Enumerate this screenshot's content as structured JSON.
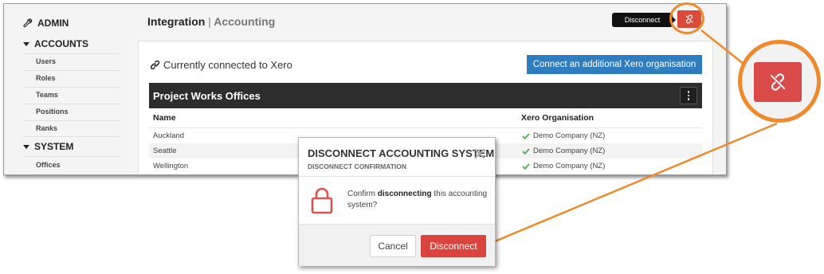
{
  "sidebar": {
    "admin_label": "ADMIN",
    "accounts_label": "ACCOUNTS",
    "accounts_items": [
      "Users",
      "Roles",
      "Teams",
      "Positions",
      "Ranks"
    ],
    "system_label": "SYSTEM",
    "system_items": [
      "Offices"
    ]
  },
  "header": {
    "title": "Integration",
    "separator": "|",
    "crumb": "Accounting",
    "tooltip": "Disconnect"
  },
  "card": {
    "status_text": "Currently connected to Xero",
    "connect_button": "Connect an additional Xero organisation",
    "table_title": "Project Works Offices",
    "columns": [
      "Name",
      "Xero Organisation"
    ],
    "rows": [
      {
        "name": "Auckland",
        "org": "Demo Company (NZ)"
      },
      {
        "name": "Seattle",
        "org": "Demo Company (NZ)"
      },
      {
        "name": "Wellington",
        "org": "Demo Company (NZ)"
      }
    ]
  },
  "modal": {
    "title": "DISCONNECT ACCOUNTING SYSTEM",
    "subtitle": "DISCONNECT CONFIRMATION",
    "close": "✕",
    "msg_pre": "Confirm ",
    "msg_bold": "disconnecting",
    "msg_post": " this accounting system?",
    "cancel_label": "Cancel",
    "disconnect_label": "Disconnect"
  },
  "colors": {
    "accent_blue": "#2f7dbf",
    "danger_red": "#d9443f",
    "callout_orange": "#ee8a2b",
    "check_green": "#4caf50"
  },
  "icons": [
    "wrench-icon",
    "link-icon",
    "unlink-icon",
    "kebab-icon",
    "check-icon",
    "lock-icon",
    "close-icon"
  ]
}
